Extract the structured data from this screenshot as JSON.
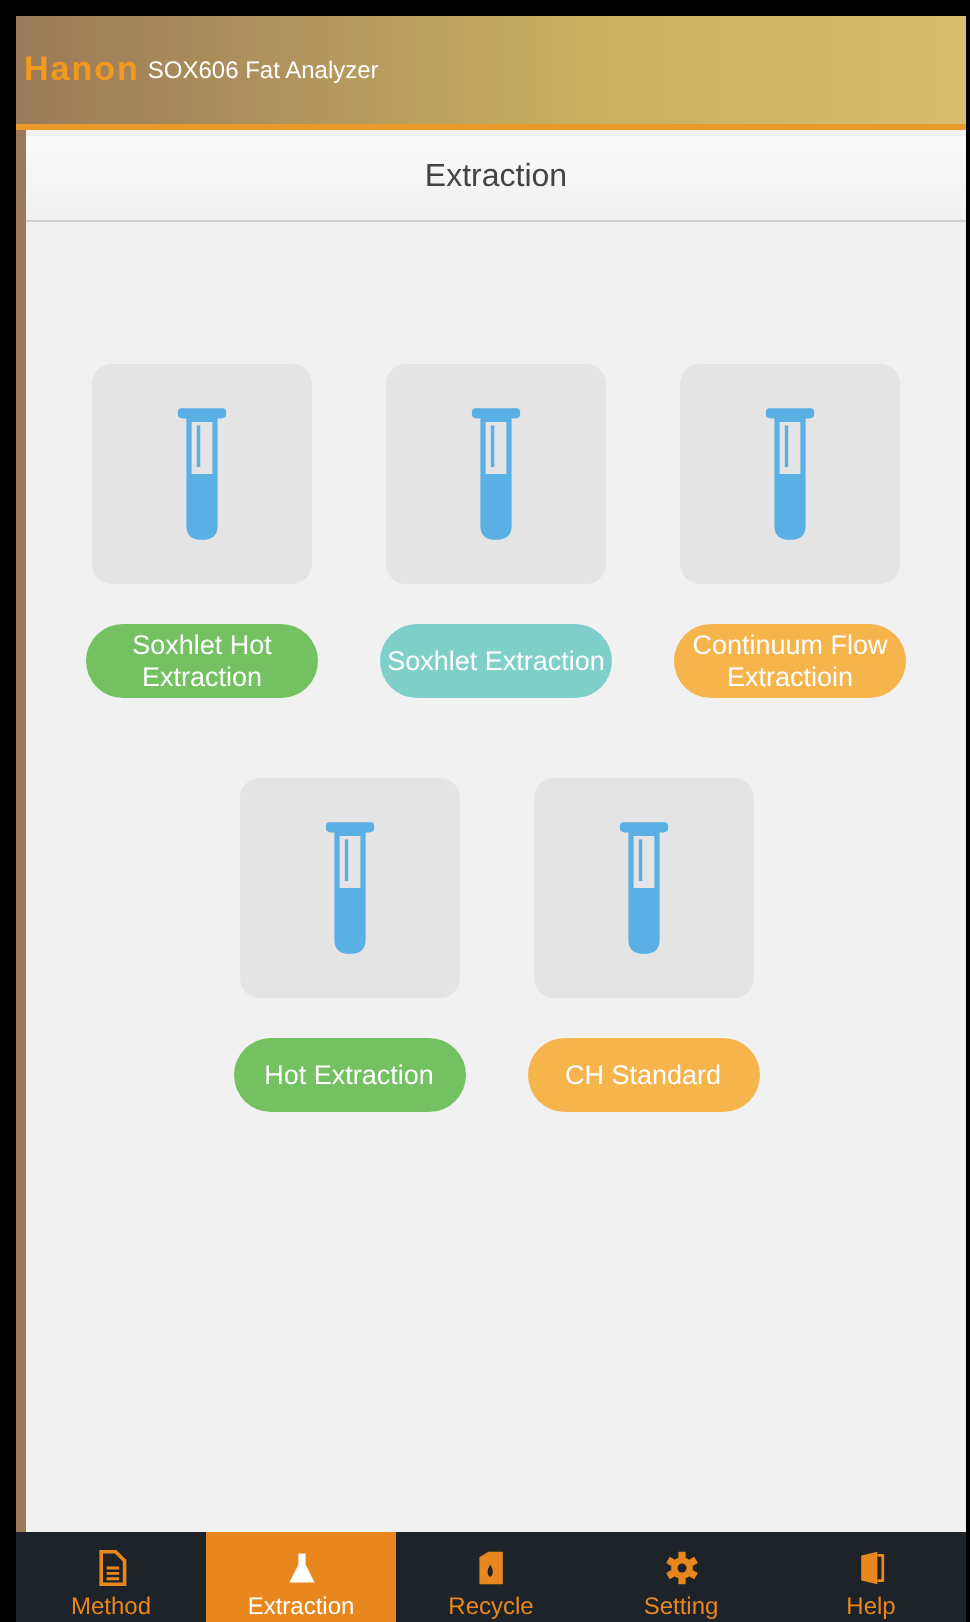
{
  "header": {
    "logo": "Hanon",
    "title": "SOX606 Fat Analyzer"
  },
  "page_title": "Extraction",
  "methods": [
    {
      "label": "Soxhlet Hot Extraction",
      "color": "#74c161"
    },
    {
      "label": "Soxhlet Extraction",
      "color": "#7fcfcb"
    },
    {
      "label": "Continuum Flow Extractioin",
      "color": "#f6b44c"
    },
    {
      "label": "Hot Extraction",
      "color": "#74c161"
    },
    {
      "label": "CH Standard",
      "color": "#f6b44c"
    }
  ],
  "tabs": [
    {
      "label": "Method",
      "kind": "document",
      "selected": false
    },
    {
      "label": "Extraction",
      "kind": "flask",
      "selected": true
    },
    {
      "label": "Recycle",
      "kind": "recycle",
      "selected": false
    },
    {
      "label": "Setting",
      "kind": "gear",
      "selected": false
    },
    {
      "label": "Help",
      "kind": "help",
      "selected": false
    }
  ]
}
